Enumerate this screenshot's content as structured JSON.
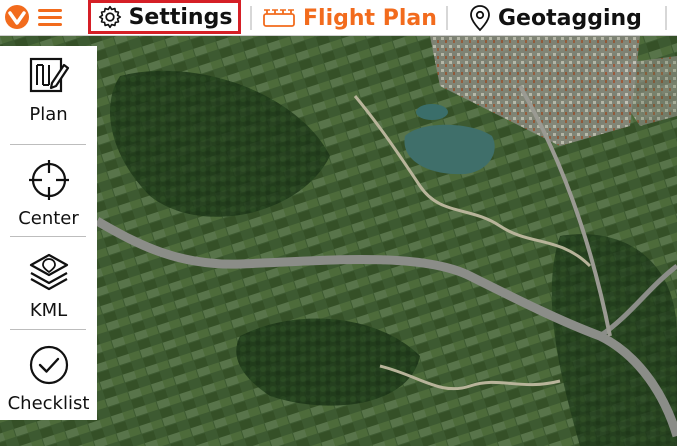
{
  "colors": {
    "accent": "#f26b1d",
    "selected_border": "#d51f26",
    "text": "#111111"
  },
  "topbar": {
    "logo_icon": "brand-logo-icon",
    "menu_icon": "hamburger-menu-icon",
    "settings_label": "Settings",
    "settings_icon": "gear-icon",
    "flight_plan_label": "Flight Plan",
    "flight_plan_icon": "drone-plan-icon",
    "geotagging_label": "Geotagging",
    "geotagging_icon": "map-pin-icon"
  },
  "toolbar": {
    "items": [
      {
        "label": "Plan",
        "icon": "plan-edit-icon"
      },
      {
        "label": "Center",
        "icon": "crosshair-icon"
      },
      {
        "label": "KML",
        "icon": "kml-layers-icon"
      },
      {
        "label": "Checklist",
        "icon": "check-circle-icon"
      }
    ]
  }
}
